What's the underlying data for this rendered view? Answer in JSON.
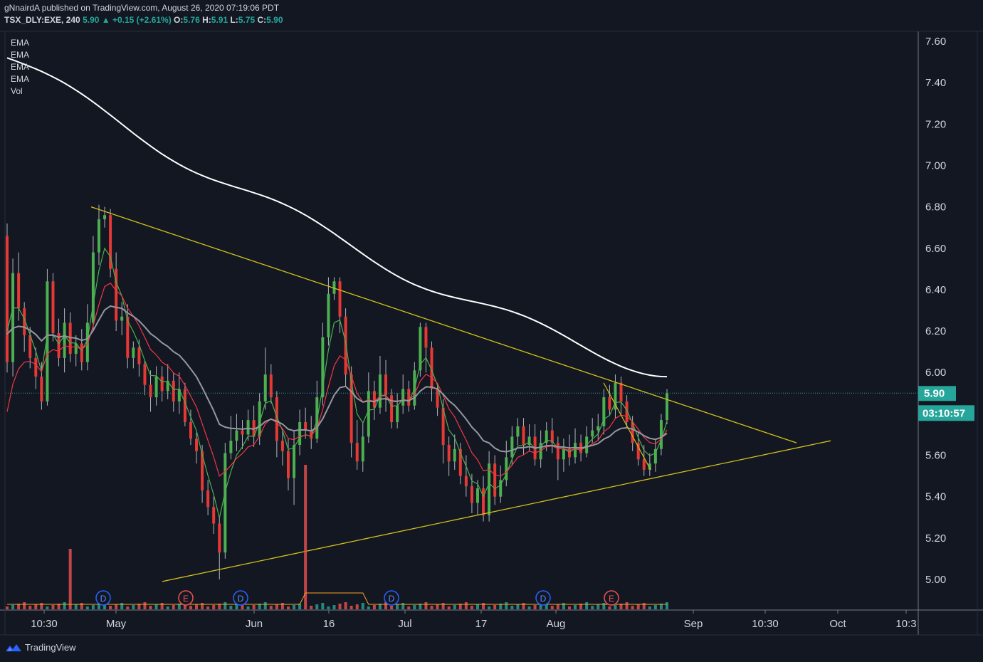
{
  "header": {
    "published_line": "gNnairdA published on TradingView.com, August 26, 2020 07:19:06 PDT",
    "symbol": "TSX_DLY:EXE, 240",
    "last": "5.90",
    "change": "▲ +0.15 (+2.61%)",
    "o_label": "O:",
    "o_val": "5.76",
    "h_label": "H:",
    "h_val": "5.91",
    "l_label": "L:",
    "l_val": "5.75",
    "c_label": "C:",
    "c_val": "5.90"
  },
  "indicators": [
    "EMA",
    "EMA",
    "EMA",
    "EMA",
    "Vol"
  ],
  "footer": {
    "brand": "TradingView"
  },
  "colors": {
    "background": "#131722",
    "up": "#26a69a",
    "down": "#ef5350",
    "ema_fast": "#4caf50",
    "ema_mid": "#f23645",
    "ema_slow": "#9598a1",
    "ema_long": "#ffffff",
    "trendline": "#d4c11c",
    "price_label": "#26a69a"
  },
  "chart_data": {
    "type": "candlestick",
    "title": "",
    "ylim": [
      4.85,
      7.68
    ],
    "y_ticks": [
      "7.60",
      "7.40",
      "7.20",
      "7.00",
      "6.80",
      "6.60",
      "6.40",
      "6.20",
      "6.00",
      "5.80",
      "5.60",
      "5.40",
      "5.20",
      "5.00"
    ],
    "x_tick_labels": [
      "10:30",
      "May",
      "Jun",
      "16",
      "Jul",
      "17",
      "Aug",
      "Sep",
      "10:30",
      "Oct",
      "10:3"
    ],
    "last_price_label": "5.90",
    "countdown_label": "03:10:57",
    "candles": [
      [
        6.66,
        6.05,
        6.72,
        6.0
      ],
      [
        6.05,
        6.48,
        6.55,
        5.98
      ],
      [
        6.48,
        6.31,
        6.58,
        6.25
      ],
      [
        6.31,
        6.18,
        6.34,
        6.1
      ],
      [
        6.18,
        6.07,
        6.22,
        6.02
      ],
      [
        6.07,
        5.98,
        6.12,
        5.92
      ],
      [
        5.98,
        5.86,
        6.05,
        5.82
      ],
      [
        5.86,
        6.44,
        6.5,
        5.84
      ],
      [
        6.44,
        6.19,
        6.48,
        6.15
      ],
      [
        6.19,
        6.07,
        6.26,
        6.03
      ],
      [
        6.07,
        6.24,
        6.31,
        6.0
      ],
      [
        6.24,
        6.09,
        6.29,
        6.05
      ],
      [
        6.09,
        6.14,
        6.18,
        6.03
      ],
      [
        6.14,
        6.05,
        6.21,
        6.01
      ],
      [
        6.05,
        6.24,
        6.33,
        6.01
      ],
      [
        6.24,
        6.58,
        6.66,
        6.2
      ],
      [
        6.58,
        6.74,
        6.81,
        6.52
      ],
      [
        6.74,
        6.76,
        6.8,
        6.7
      ],
      [
        6.76,
        6.5,
        6.79,
        6.46
      ],
      [
        6.5,
        6.25,
        6.58,
        6.2
      ],
      [
        6.25,
        6.27,
        6.34,
        6.18
      ],
      [
        6.27,
        6.07,
        6.33,
        6.02
      ],
      [
        6.07,
        6.12,
        6.15,
        6.02
      ],
      [
        6.12,
        6.04,
        6.16,
        5.98
      ],
      [
        6.04,
        5.94,
        6.06,
        5.89
      ],
      [
        5.94,
        5.88,
        6.01,
        5.81
      ],
      [
        5.88,
        5.98,
        6.03,
        5.84
      ],
      [
        5.98,
        5.91,
        6.03,
        5.86
      ],
      [
        5.91,
        5.96,
        6.04,
        5.87
      ],
      [
        5.96,
        5.86,
        6.0,
        5.81
      ],
      [
        5.86,
        5.92,
        6.0,
        5.8
      ],
      [
        5.92,
        5.76,
        5.95,
        5.74
      ],
      [
        5.76,
        5.68,
        5.82,
        5.65
      ],
      [
        5.68,
        5.62,
        5.71,
        5.56
      ],
      [
        5.62,
        5.43,
        5.65,
        5.37
      ],
      [
        5.43,
        5.35,
        5.48,
        5.31
      ],
      [
        5.35,
        5.27,
        5.4,
        5.22
      ],
      [
        5.27,
        5.13,
        5.3,
        5.0
      ],
      [
        5.13,
        5.61,
        5.66,
        5.1
      ],
      [
        5.61,
        5.67,
        5.79,
        5.58
      ],
      [
        5.67,
        5.72,
        5.8,
        5.62
      ],
      [
        5.72,
        5.7,
        5.77,
        5.63
      ],
      [
        5.7,
        5.77,
        5.82,
        5.67
      ],
      [
        5.77,
        5.69,
        5.84,
        5.64
      ],
      [
        5.69,
        5.86,
        5.9,
        5.65
      ],
      [
        5.86,
        5.99,
        6.12,
        5.82
      ],
      [
        5.99,
        5.88,
        6.04,
        5.85
      ],
      [
        5.88,
        5.67,
        5.91,
        5.59
      ],
      [
        5.67,
        5.62,
        5.72,
        5.55
      ],
      [
        5.62,
        5.49,
        5.68,
        5.43
      ],
      [
        5.49,
        5.65,
        5.72,
        5.36
      ],
      [
        5.65,
        5.76,
        5.82,
        5.6
      ],
      [
        5.76,
        5.72,
        5.83,
        5.68
      ],
      [
        5.72,
        5.68,
        5.79,
        5.63
      ],
      [
        5.68,
        5.88,
        5.96,
        5.66
      ],
      [
        5.88,
        6.17,
        6.24,
        5.84
      ],
      [
        6.17,
        6.38,
        6.46,
        6.13
      ],
      [
        6.38,
        6.44,
        6.46,
        6.35
      ],
      [
        6.44,
        6.27,
        6.46,
        6.19
      ],
      [
        6.27,
        5.99,
        6.31,
        5.93
      ],
      [
        5.99,
        5.66,
        6.03,
        5.59
      ],
      [
        5.66,
        5.57,
        5.77,
        5.53
      ],
      [
        5.57,
        5.69,
        5.76,
        5.52
      ],
      [
        5.69,
        5.91,
        6.0,
        5.66
      ],
      [
        5.91,
        5.83,
        5.96,
        5.77
      ],
      [
        5.83,
        5.99,
        6.08,
        5.8
      ],
      [
        5.99,
        5.89,
        6.06,
        5.81
      ],
      [
        5.89,
        5.76,
        5.92,
        5.73
      ],
      [
        5.76,
        5.84,
        5.9,
        5.73
      ],
      [
        5.84,
        5.92,
        5.99,
        5.8
      ],
      [
        5.92,
        5.84,
        5.96,
        5.81
      ],
      [
        5.84,
        6.01,
        6.05,
        5.82
      ],
      [
        6.01,
        6.22,
        6.24,
        5.98
      ],
      [
        6.22,
        6.12,
        6.24,
        6.0
      ],
      [
        6.12,
        5.92,
        6.15,
        5.86
      ],
      [
        5.92,
        5.83,
        5.95,
        5.79
      ],
      [
        5.83,
        5.65,
        5.87,
        5.56
      ],
      [
        5.65,
        5.57,
        5.69,
        5.5
      ],
      [
        5.57,
        5.63,
        5.7,
        5.53
      ],
      [
        5.63,
        5.5,
        5.66,
        5.46
      ],
      [
        5.5,
        5.45,
        5.6,
        5.4
      ],
      [
        5.45,
        5.37,
        5.51,
        5.32
      ],
      [
        5.37,
        5.44,
        5.48,
        5.31
      ],
      [
        5.44,
        5.31,
        5.5,
        5.28
      ],
      [
        5.31,
        5.56,
        5.62,
        5.28
      ],
      [
        5.56,
        5.4,
        5.6,
        5.36
      ],
      [
        5.4,
        5.48,
        5.55,
        5.37
      ],
      [
        5.48,
        5.59,
        5.67,
        5.45
      ],
      [
        5.59,
        5.69,
        5.74,
        5.55
      ],
      [
        5.69,
        5.74,
        5.78,
        5.65
      ],
      [
        5.74,
        5.65,
        5.78,
        5.6
      ],
      [
        5.65,
        5.69,
        5.75,
        5.62
      ],
      [
        5.69,
        5.58,
        5.75,
        5.55
      ],
      [
        5.58,
        5.66,
        5.72,
        5.54
      ],
      [
        5.66,
        5.72,
        5.76,
        5.62
      ],
      [
        5.72,
        5.66,
        5.78,
        5.61
      ],
      [
        5.66,
        5.58,
        5.69,
        5.48
      ],
      [
        5.58,
        5.63,
        5.68,
        5.52
      ],
      [
        5.63,
        5.59,
        5.7,
        5.55
      ],
      [
        5.59,
        5.66,
        5.73,
        5.56
      ],
      [
        5.66,
        5.61,
        5.7,
        5.57
      ],
      [
        5.61,
        5.69,
        5.74,
        5.59
      ],
      [
        5.69,
        5.72,
        5.78,
        5.66
      ],
      [
        5.72,
        5.74,
        5.8,
        5.67
      ],
      [
        5.74,
        5.88,
        5.92,
        5.7
      ],
      [
        5.88,
        5.82,
        5.94,
        5.79
      ],
      [
        5.82,
        5.95,
        5.99,
        5.78
      ],
      [
        5.95,
        5.86,
        5.98,
        5.8
      ],
      [
        5.86,
        5.76,
        5.89,
        5.73
      ],
      [
        5.76,
        5.66,
        5.79,
        5.62
      ],
      [
        5.66,
        5.58,
        5.71,
        5.55
      ],
      [
        5.58,
        5.53,
        5.65,
        5.5
      ],
      [
        5.53,
        5.56,
        5.61,
        5.5
      ],
      [
        5.56,
        5.63,
        5.68,
        5.52
      ],
      [
        5.63,
        5.77,
        5.8,
        5.6
      ],
      [
        5.77,
        5.9,
        5.92,
        5.75
      ]
    ],
    "trendlines": [
      {
        "from": [
          5.0,
          6.8
        ],
        "to": [
          5.0,
          5.65
        ],
        "note": "upper descending"
      },
      {
        "from": [
          5.0,
          4.99
        ],
        "to": [
          5.0,
          5.66
        ],
        "note": "lower ascending"
      }
    ],
    "volume_spikes": [
      {
        "x": 0.1,
        "value": "high"
      },
      {
        "x": 0.41,
        "value": "very high"
      }
    ],
    "event_markers": [
      "D",
      "E",
      "D",
      "D",
      "D",
      "E"
    ]
  }
}
